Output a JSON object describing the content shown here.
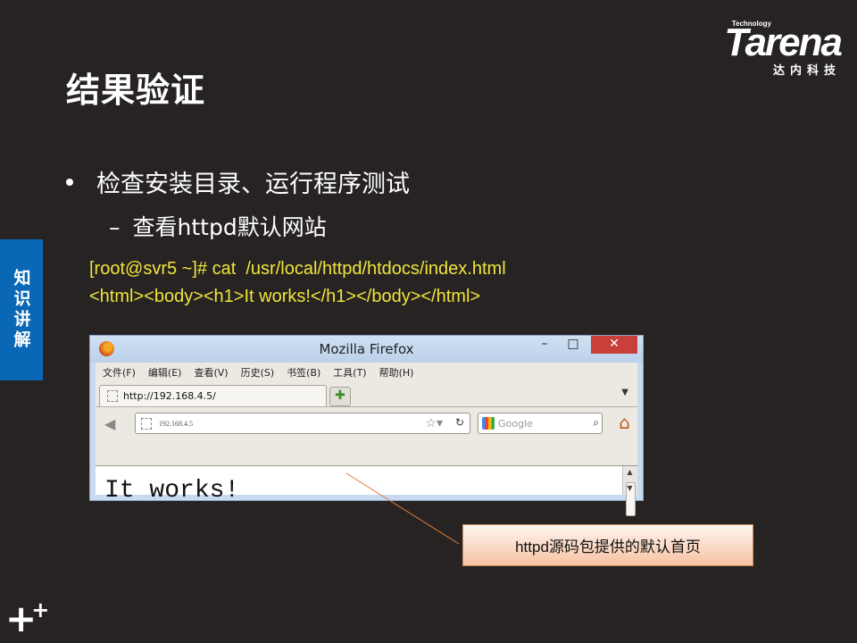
{
  "logo": {
    "tech": "Technology",
    "main": "Tarena",
    "sub": "达内科技"
  },
  "slide": {
    "title": "结果验证",
    "bullet": "检查安装目录、运行程序测试",
    "sub_dash": "–",
    "sub_bullet": "查看httpd默认网站",
    "side_tab": "知识讲解",
    "code_line1": "[root@svr5 ~]# cat  /usr/local/httpd/htdocs/index.html",
    "code_line2": "<html><body><h1>It works!</h1></body></html>",
    "callout": "httpd源码包提供的默认首页"
  },
  "firefox": {
    "title": "Mozilla Firefox",
    "controls": {
      "min": "–",
      "max": "□",
      "close": "✕"
    },
    "menu": [
      "文件(F)",
      "编辑(E)",
      "查看(V)",
      "历史(S)",
      "书签(B)",
      "工具(T)",
      "帮助(H)"
    ],
    "tab_label": "http://192.168.4.5/",
    "new_tab": "✚",
    "url": "192.168.4.5",
    "search_placeholder": "Google",
    "page_text": "It works!"
  },
  "colors": {
    "background": "#262322",
    "code": "#f0e53c",
    "side_tab": "#0a67b6",
    "callout_border": "#c98a5e"
  }
}
